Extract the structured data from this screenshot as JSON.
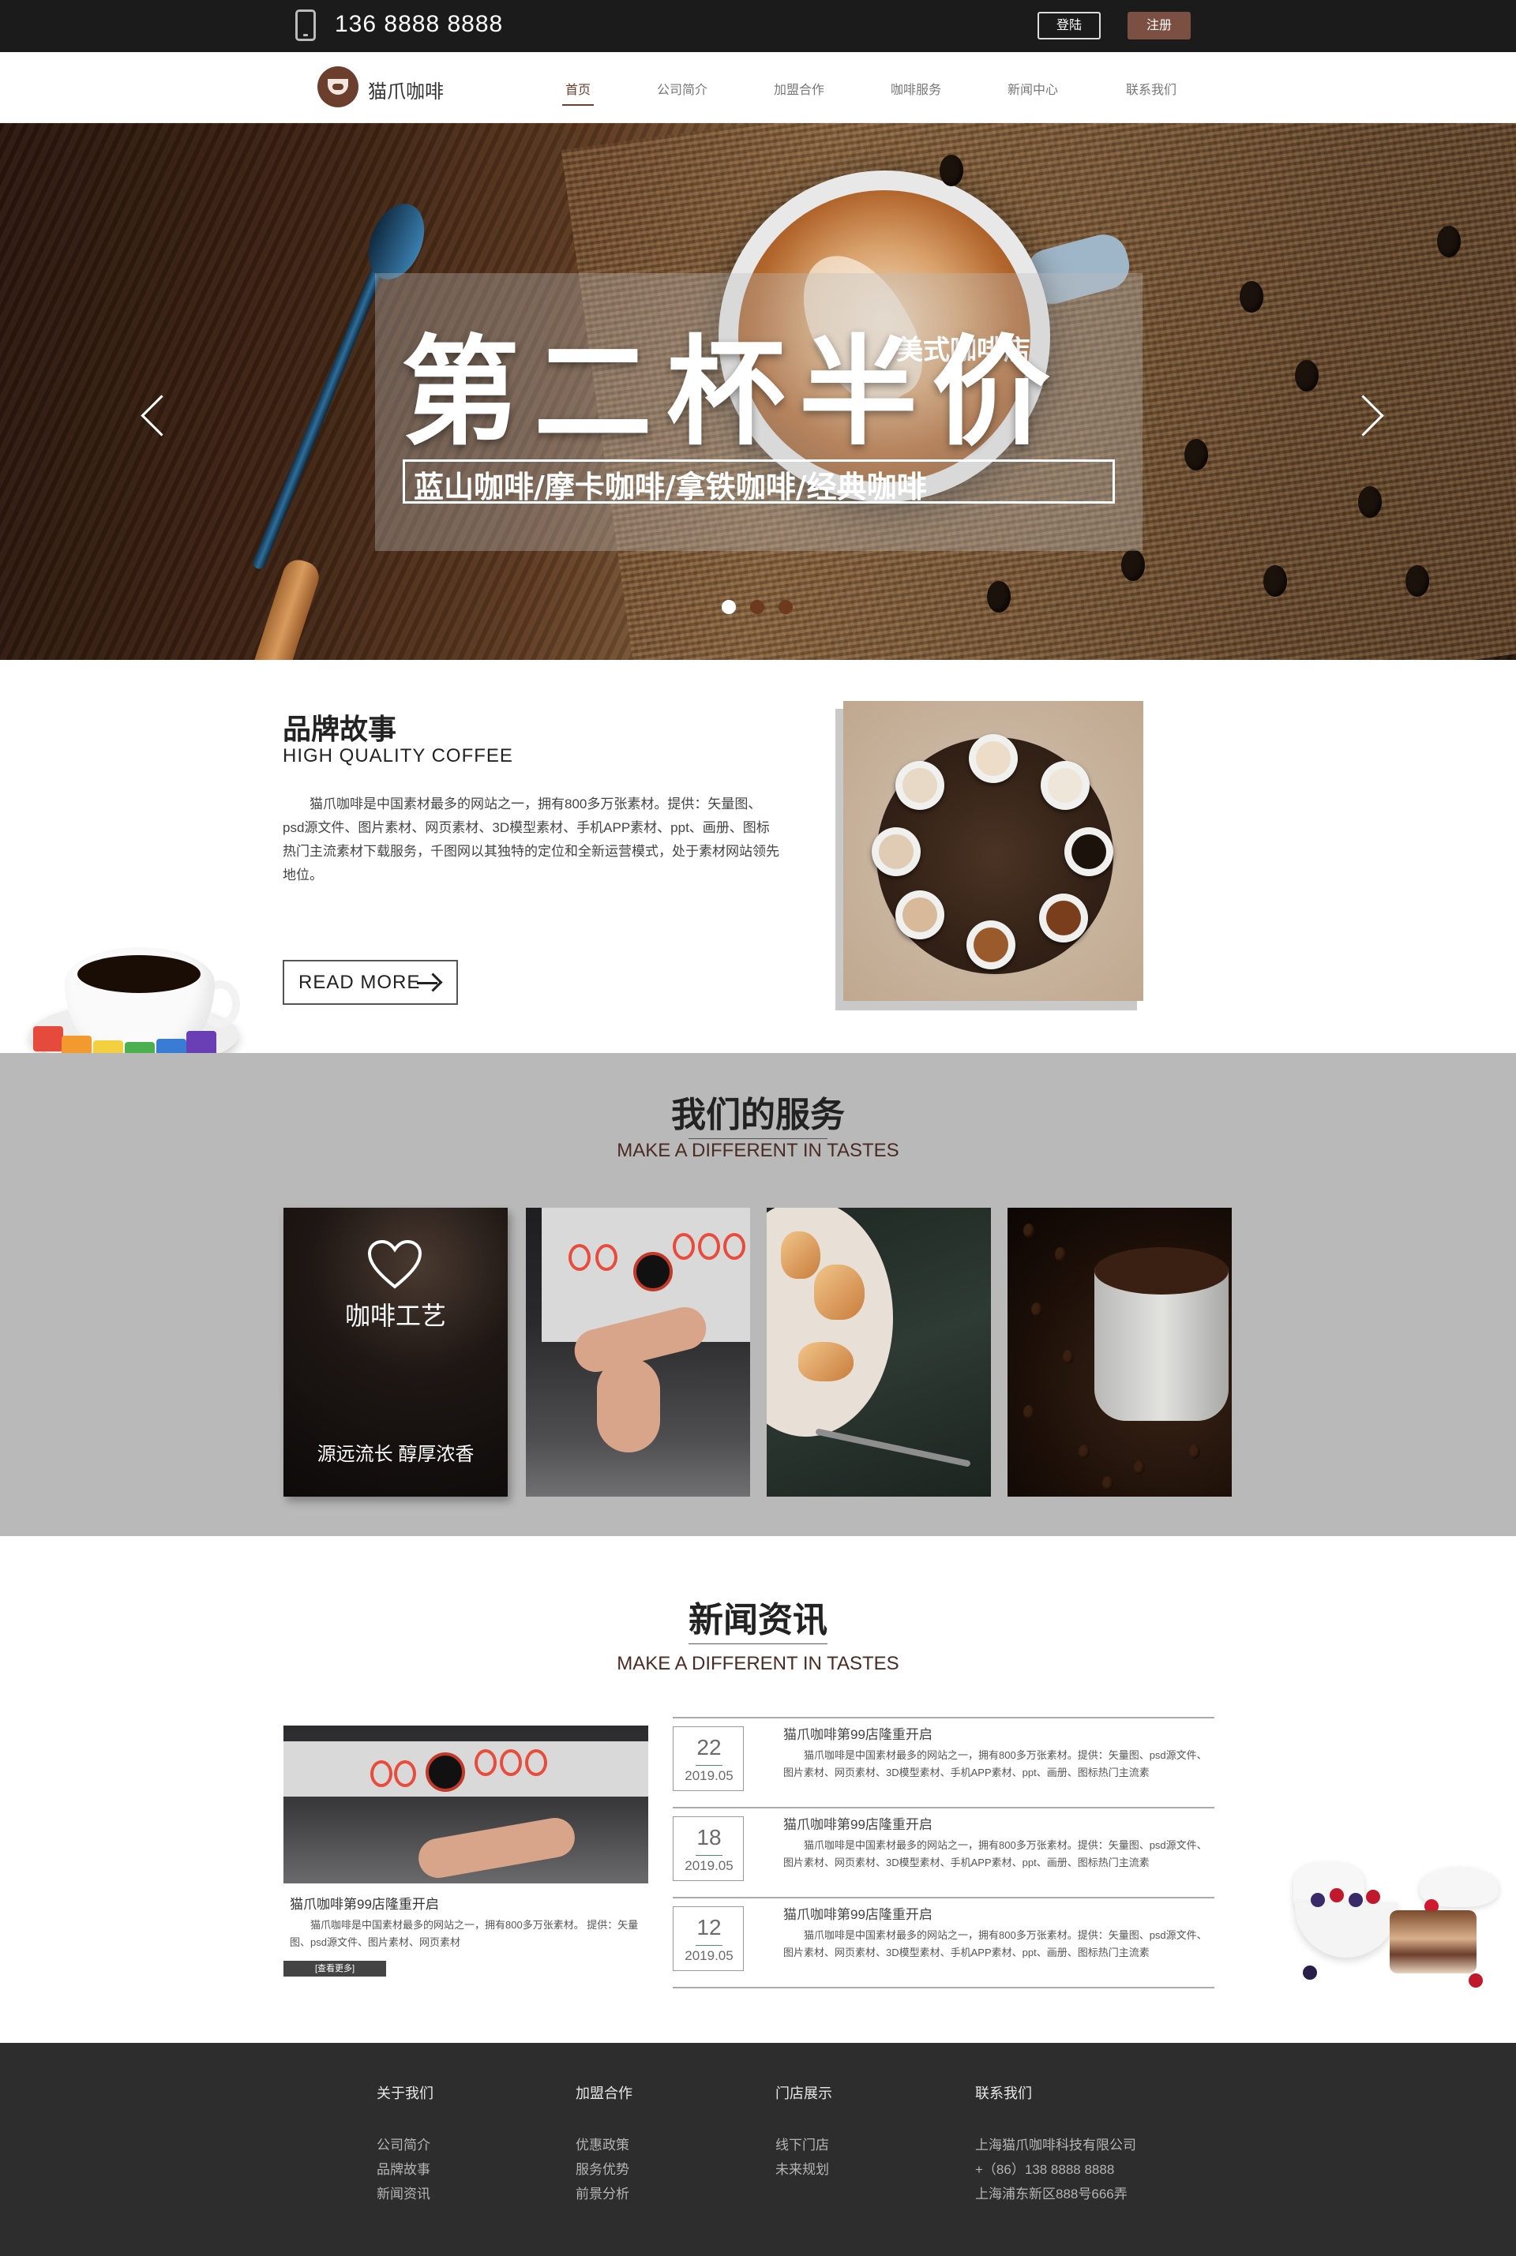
{
  "topbar": {
    "phone": "136 8888 8888",
    "login_label": "登陆",
    "register_label": "注册"
  },
  "header": {
    "brand_name": "猫爪咖啡",
    "nav": [
      {
        "label": "首页",
        "active": true
      },
      {
        "label": "公司简介",
        "active": false
      },
      {
        "label": "加盟合作",
        "active": false
      },
      {
        "label": "咖啡服务",
        "active": false
      },
      {
        "label": "新闻中心",
        "active": false
      },
      {
        "label": "联系我们",
        "active": false
      }
    ]
  },
  "banner": {
    "headline": "第二杯半价",
    "store_tag": "美式咖啡店",
    "subline": "蓝山咖啡/摩卡咖啡/拿铁咖啡/经典咖啡",
    "slide_count": 3,
    "active_slide": 1
  },
  "story": {
    "title": "品牌故事",
    "subtitle": "HIGH QUALITY COFFEE",
    "text": "猫爪咖啡是中国素材最多的网站之一，拥有800多万张素材。提供：矢量图、psd源文件、图片素材、网页素材、3D模型素材、手机APP素材、ppt、画册、图标热门主流素材下载服务，千图网以其独特的定位和全新运营模式，处于素材网站领先地位。",
    "read_more_label": "READ MORE"
  },
  "services": {
    "title": "我们的服务",
    "subtitle": "MAKE A DIFFERENT  IN TASTES",
    "card1_title": "咖啡工艺",
    "card1_foot": "源远流长 醇厚浓香"
  },
  "news": {
    "title": "新闻资讯",
    "subtitle": "MAKE A DIFFERENT  IN TASTES",
    "feature": {
      "caption": "猫爪咖啡第99店隆重开启",
      "desc": "猫爪咖啡是中国素材最多的网站之一，拥有800多万张素材。 提供：矢量图、psd源文件、图片素材、网页素材",
      "more_label": "[查看更多]"
    },
    "items": [
      {
        "day": "22",
        "ym": "2019.05",
        "title": "猫爪咖啡第99店隆重开启",
        "desc": "猫爪咖啡是中国素材最多的网站之一，拥有800多万张素材。提供：矢量图、psd源文件、图片素材、网页素材、3D模型素材、手机APP素材、ppt、画册、图标热门主流素"
      },
      {
        "day": "18",
        "ym": "2019.05",
        "title": "猫爪咖啡第99店隆重开启",
        "desc": "猫爪咖啡是中国素材最多的网站之一，拥有800多万张素材。提供：矢量图、psd源文件、图片素材、网页素材、3D模型素材、手机APP素材、ppt、画册、图标热门主流素"
      },
      {
        "day": "12",
        "ym": "2019.05",
        "title": "猫爪咖啡第99店隆重开启",
        "desc": "猫爪咖啡是中国素材最多的网站之一，拥有800多万张素材。提供：矢量图、psd源文件、图片素材、网页素材、3D模型素材、手机APP素材、ppt、画册、图标热门主流素"
      }
    ]
  },
  "footer": {
    "columns": [
      {
        "title": "关于我们",
        "links": [
          "公司简介",
          "品牌故事",
          "新闻资讯"
        ]
      },
      {
        "title": "加盟合作",
        "links": [
          "优惠政策",
          "服务优势",
          "前景分析"
        ]
      },
      {
        "title": "门店展示",
        "links": [
          "线下门店",
          "未来规划"
        ]
      },
      {
        "title": "联系我们",
        "links": [
          "上海猫爪咖啡科技有限公司",
          "+（86）138 8888 8888",
          "上海浦东新区888号666弄"
        ]
      }
    ]
  },
  "colors": {
    "brand_brown": "#6b3e2e",
    "register_button": "#7b5043",
    "services_bg": "#b9b9b9",
    "footer_bg": "#2d2d2d",
    "topbar_bg": "#1b1b1b"
  },
  "icons": {
    "phone": "phone-icon",
    "logo": "cat-paw-coffee-logo",
    "carousel_prev": "chevron-left-icon",
    "carousel_next": "chevron-right-icon",
    "read_more": "arrow-right-icon",
    "service_card": "heart-icon"
  }
}
